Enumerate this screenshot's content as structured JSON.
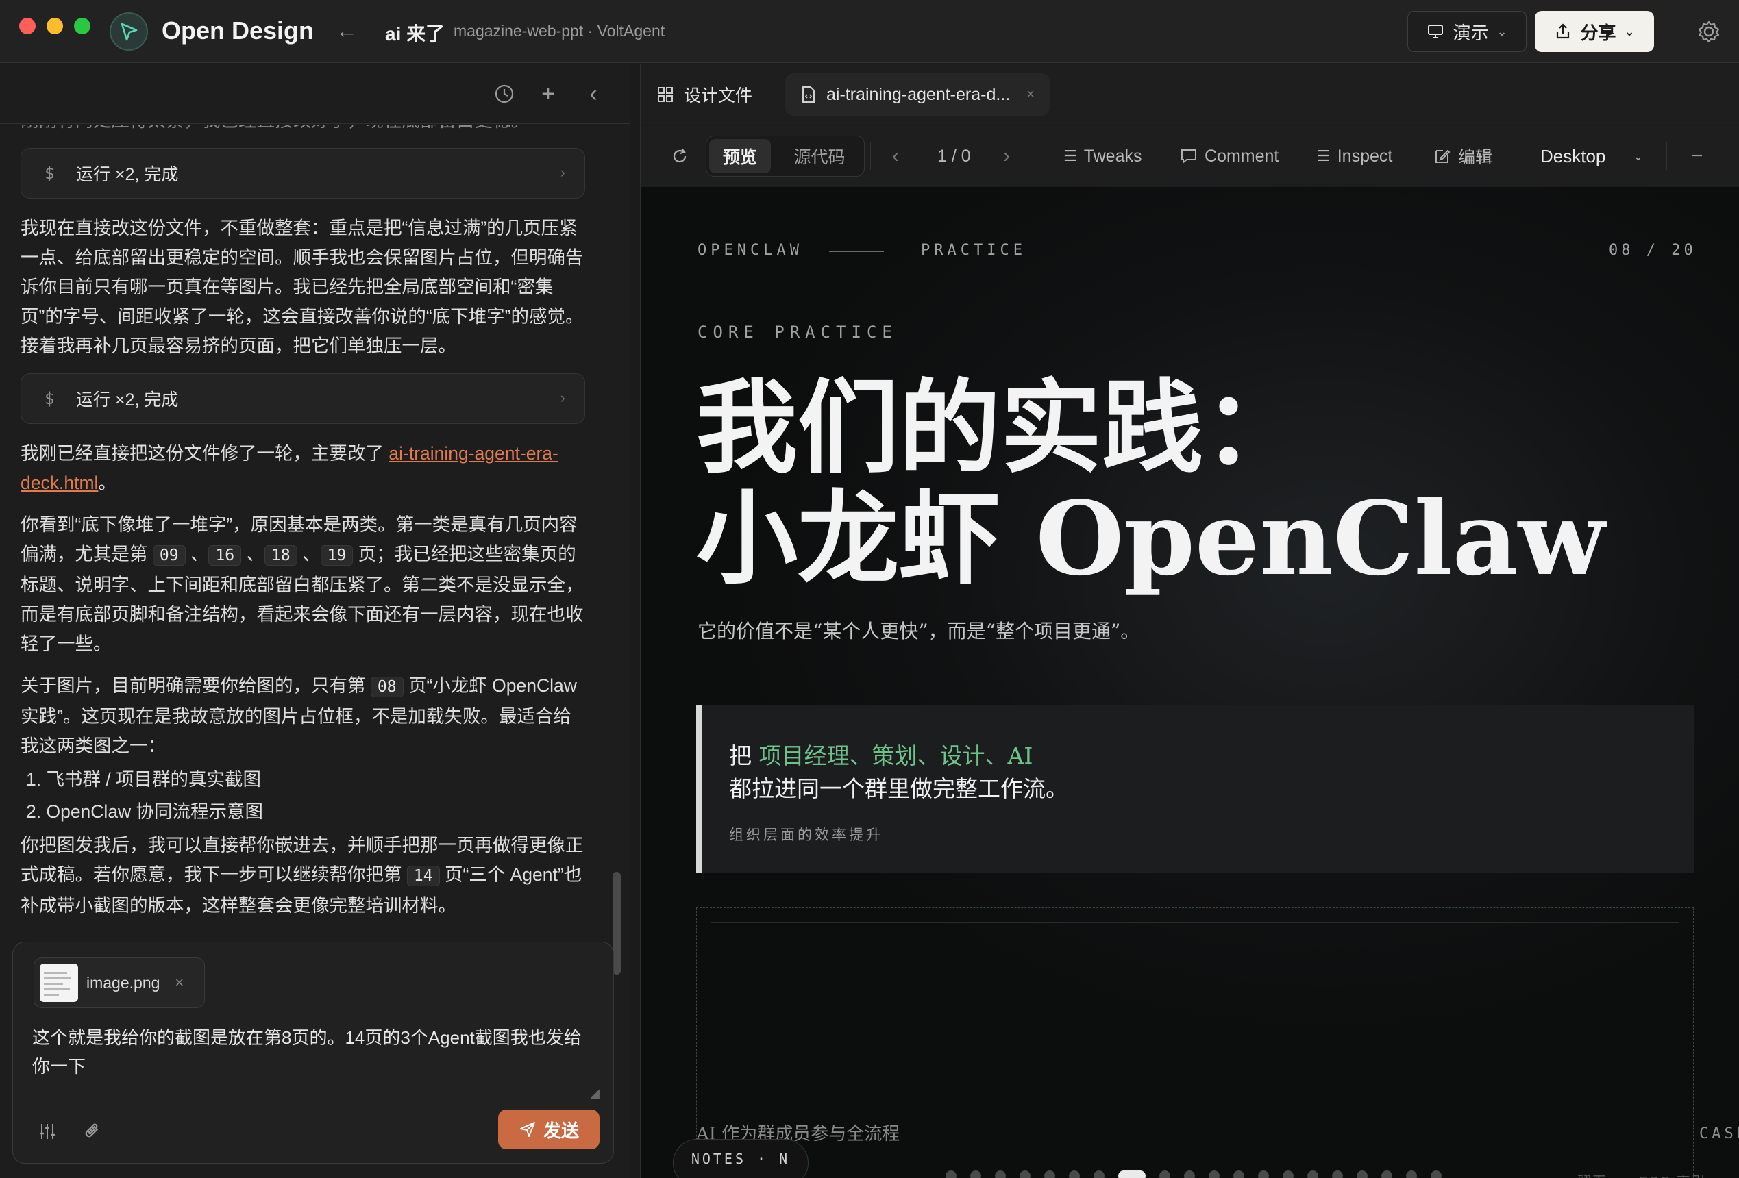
{
  "window": {
    "app_name": "Open Design",
    "project_name": "ai 来了",
    "project_sub": "magazine-web-ppt · VoltAgent",
    "present_label": "演示",
    "share_label": "分享"
  },
  "chat": {
    "cut_line": "刚刚有两处压得太紧，我已经直接改好了，现在底部留白更稳。",
    "tool_run_label": "运行 ×2, 完成",
    "msg1": "我现在直接改这份文件，不重做整套：重点是把“信息过满”的几页压紧一点、给底部留出更稳定的空间。顺手我也会保留图片占位，但明确告诉你目前只有哪一页真在等图片。我已经先把全局底部空间和“密集页”的字号、间距收紧了一轮，这会直接改善你说的“底下堆字”的感觉。接着我再补几页最容易挤的页面，把它们单独压一层。",
    "msg2_prefix": "我刚已经直接把这份文件修了一轮，主要改了 ",
    "msg2_link": "ai-training-agent-era-deck.html",
    "msg2_suffix": "。",
    "msg3_a": "你看到“底下像堆了一堆字”，原因基本是两类。第一类是真有几页内容偏满，尤其是第 ",
    "msg3_p1": "09",
    "msg3_sep1": " 、",
    "msg3_p2": "16",
    "msg3_sep2": " 、",
    "msg3_p3": "18",
    "msg3_sep3": " 、",
    "msg3_p4": "19",
    "msg3_b": " 页；我已经把这些密集页的标题、说明字、上下间距和底部留白都压紧了。第二类不是没显示全，而是有底部页脚和备注结构，看起来会像下面还有一层内容，现在也收轻了一些。",
    "msg4_a": "关于图片，目前明确需要你给图的，只有第 ",
    "msg4_page": "08",
    "msg4_b": " 页“小龙虾 OpenClaw 实践”。这页现在是我故意放的图片占位框，不是加载失败。最适合给我这两类图之一：",
    "list": [
      "1. 飞书群 / 项目群的真实截图",
      "2. OpenClaw 协同流程示意图"
    ],
    "msg5_a": "你把图发我后，我可以直接帮你嵌进去，并顺手把那一页再做得更像正式成稿。若你愿意，我下一步可以继续帮你把第 ",
    "msg5_page": "14",
    "msg5_b": " 页“三个 Agent”也补成带小截图的版本，这样整套会更像完整培训材料。"
  },
  "composer": {
    "attachment_name": "image.png",
    "text": "这个就是我给你的截图是放在第8页的。14页的3个Agent截图我也发给你一下",
    "send_label": "发送"
  },
  "tabs": {
    "design_files": "设计文件",
    "file_tab": "ai-training-agent-era-d..."
  },
  "preview_toolbar": {
    "preview": "预览",
    "source": "源代码",
    "page_counter": "1 / 0",
    "tweaks": "Tweaks",
    "comment": "Comment",
    "inspect": "Inspect",
    "edit": "编辑",
    "device": "Desktop"
  },
  "slide": {
    "kicker_left": "OPENCLAW",
    "kicker_right": "PRACTICE",
    "page_index": "08 / 20",
    "eyebrow": "CORE PRACTICE",
    "title_line1": "我们的实践：",
    "title_line2": "小龙虾 OpenClaw",
    "subtitle": "它的价值不是“某个人更快”，而是“整个项目更通”。",
    "callout_prefix": "把 ",
    "callout_highlight": "项目经理、策划、设计、AI",
    "callout_line2": "都拉进同一个群里做完整工作流。",
    "callout_note": "组织层面的效率提升",
    "image_caption": "AI 作为群成员参与全流程",
    "case_label": "CASE",
    "notes_label": "NOTES · N",
    "hint_left": "翻页",
    "hint_right": "ESC 索引"
  },
  "colors": {
    "accent": "#c96a43",
    "highlight_green": "#6fc28a",
    "link": "#e07a4f"
  }
}
